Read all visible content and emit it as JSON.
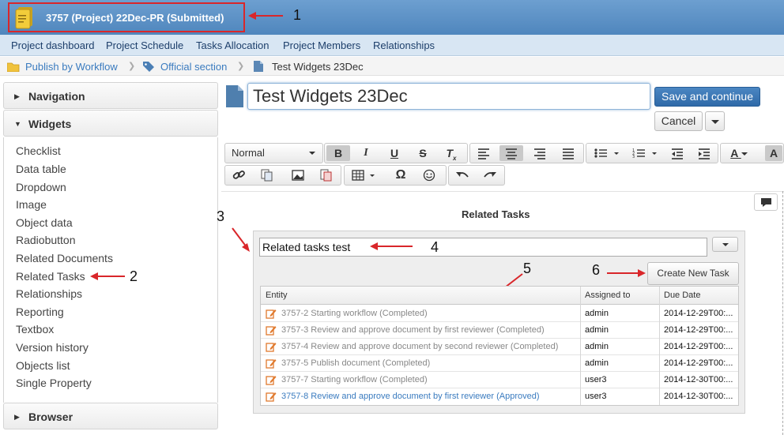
{
  "header": {
    "project_title": "3757 (Project) 22Dec-PR (Submitted)"
  },
  "menu": {
    "items": [
      "Project dashboard",
      "Project Schedule",
      "Tasks Allocation",
      "Project Members",
      "Relationships"
    ]
  },
  "breadcrumb": {
    "items": [
      "Publish by Workflow",
      "Official section",
      "Test Widgets 23Dec"
    ]
  },
  "sidebar": {
    "sections": [
      "Navigation",
      "Widgets",
      "Browser"
    ],
    "widgets": [
      "Checklist",
      "Data table",
      "Dropdown",
      "Image",
      "Object data",
      "Radiobutton",
      "Related Documents",
      "Related Tasks",
      "Relationships",
      "Reporting",
      "Textbox",
      "Version history",
      "Objects list",
      "Single Property"
    ]
  },
  "editor": {
    "title_value": "Test Widgets 23Dec",
    "save_label": "Save and continue",
    "cancel_label": "Cancel",
    "format_select": "Normal"
  },
  "related_tasks": {
    "heading": "Related Tasks",
    "input_value": "Related tasks test",
    "create_label": "Create New Task",
    "columns": [
      "Entity",
      "Assigned to",
      "Due Date"
    ],
    "rows": [
      {
        "entity": "3757-2 Starting workflow (Completed)",
        "assigned": "admin",
        "due": "2014-12-29T00:..."
      },
      {
        "entity": "3757-3 Review and approve document by first reviewer (Completed)",
        "assigned": "admin",
        "due": "2014-12-29T00:..."
      },
      {
        "entity": "3757-4 Review and approve document by second reviewer (Completed)",
        "assigned": "admin",
        "due": "2014-12-29T00:..."
      },
      {
        "entity": "3757-5 Publish document (Completed)",
        "assigned": "admin",
        "due": "2014-12-29T00:..."
      },
      {
        "entity": "3757-7 Starting workflow (Completed)",
        "assigned": "user3",
        "due": "2014-12-30T00:..."
      },
      {
        "entity": "3757-8 Review and approve document by first reviewer (Approved)",
        "assigned": "user3",
        "due": "2014-12-30T00:..."
      }
    ]
  },
  "annotations": [
    "1",
    "2",
    "3",
    "4",
    "5",
    "6"
  ],
  "colors": {
    "accent": "#3a7bbf",
    "annotation_red": "#d9262a"
  }
}
